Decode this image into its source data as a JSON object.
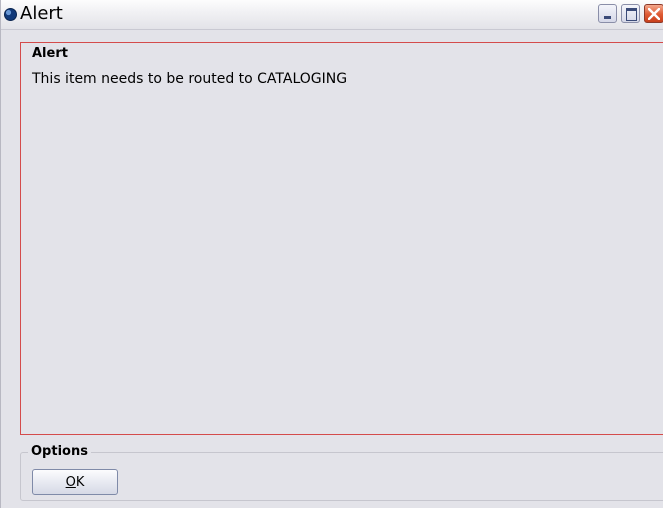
{
  "window": {
    "title": "Alert",
    "controls": {
      "minimize": "minimize-icon",
      "maximize": "maximize-icon",
      "close": "close-icon"
    }
  },
  "alert": {
    "heading": "Alert",
    "message": "This item needs to be routed to CATALOGING"
  },
  "options": {
    "legend": "Options",
    "ok_label_mnemonic": "O",
    "ok_label_rest": "K"
  },
  "colors": {
    "alert_border": "#d44b4b",
    "background": "#e3e3e9",
    "close_button": "#de5a33"
  }
}
